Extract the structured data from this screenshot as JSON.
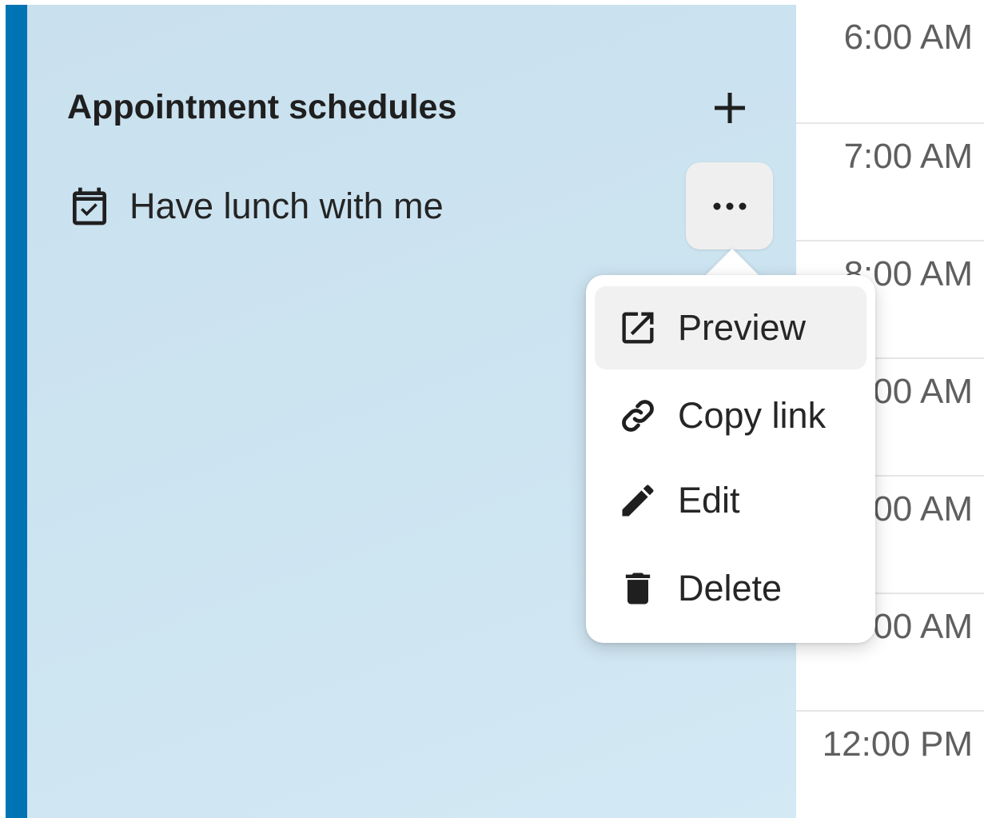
{
  "sidebar": {
    "section_title": "Appointment schedules",
    "add_icon": "plus-icon",
    "items": [
      {
        "label": "Have lunch with me",
        "icon": "calendar-check-icon"
      }
    ],
    "more_icon": "more-horizontal-icon"
  },
  "menu": {
    "items": [
      {
        "label": "Preview",
        "icon": "external-link-icon"
      },
      {
        "label": "Copy link",
        "icon": "link-icon"
      },
      {
        "label": "Edit",
        "icon": "pencil-icon"
      },
      {
        "label": "Delete",
        "icon": "trash-icon"
      }
    ]
  },
  "time_column": {
    "labels": [
      "6:00 AM",
      "7:00 AM",
      "8:00 AM",
      "9:00 AM",
      "10:00 AM",
      "11:00 AM",
      "12:00 PM"
    ]
  },
  "colors": {
    "accent": "#0073b4",
    "sidebar_bg": "#cde4f1",
    "menu_hover": "#f1f1f1",
    "text": "#242424",
    "time_text": "#5f5f5f"
  }
}
